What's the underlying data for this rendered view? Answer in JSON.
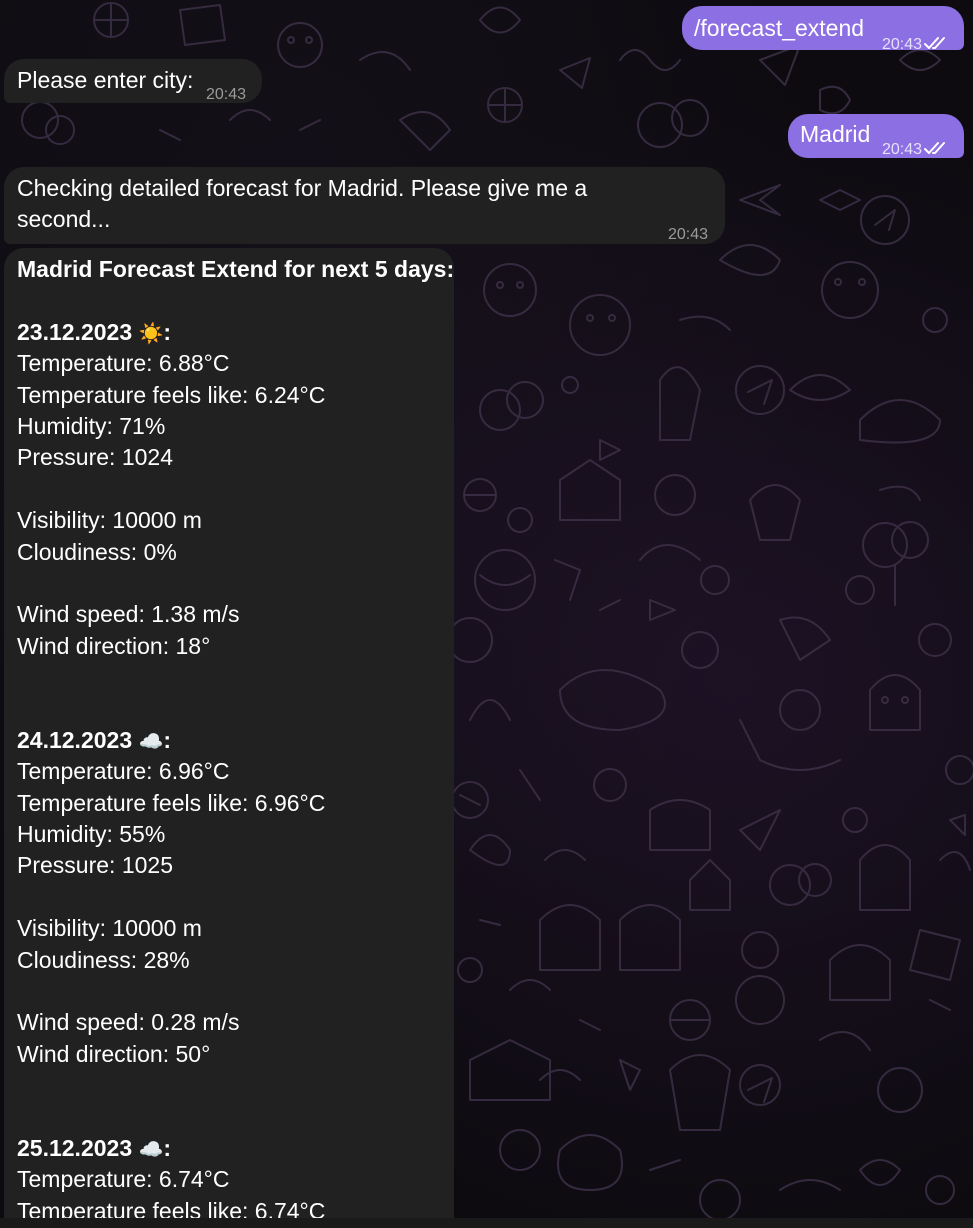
{
  "colors": {
    "outgoing_bubble": "#8c6fe3",
    "incoming_bubble": "#212121",
    "background": "#0d0b10"
  },
  "messages": {
    "m1": {
      "text": "/forecast_extend",
      "time": "20:43",
      "status_icon": "double-check-icon"
    },
    "m2": {
      "text": "Please enter city:",
      "time": "20:43"
    },
    "m3": {
      "text": "Madrid",
      "time": "20:43",
      "status_icon": "double-check-icon"
    },
    "m4": {
      "text": "Checking detailed forecast for Madrid. Please give me a second...",
      "time": "20:43"
    },
    "m5": {
      "title": "Madrid Forecast Extend for next 5 days:",
      "days": [
        {
          "date": "23.12.2023",
          "icon": "sun-icon",
          "emoji": "☀️",
          "temperature": "Temperature: 6.88°C",
          "feels_like": "Temperature feels like: 6.24°C",
          "humidity": "Humidity: 71%",
          "pressure": "Pressure: 1024",
          "visibility": "Visibility: 10000 m",
          "cloudiness": "Cloudiness: 0%",
          "wind_speed": "Wind speed: 1.38 m/s",
          "wind_direction": "Wind direction: 18°"
        },
        {
          "date": "24.12.2023",
          "icon": "cloud-icon",
          "emoji": "☁️",
          "temperature": "Temperature: 6.96°C",
          "feels_like": "Temperature feels like: 6.96°C",
          "humidity": "Humidity: 55%",
          "pressure": "Pressure: 1025",
          "visibility": "Visibility: 10000 m",
          "cloudiness": "Cloudiness: 28%",
          "wind_speed": "Wind speed: 0.28 m/s",
          "wind_direction": "Wind direction: 50°"
        },
        {
          "date": "25.12.2023",
          "icon": "cloud-icon",
          "emoji": "☁️",
          "temperature": "Temperature: 6.74°C",
          "feels_like": "Temperature feels like: 6.74°C"
        }
      ]
    }
  }
}
